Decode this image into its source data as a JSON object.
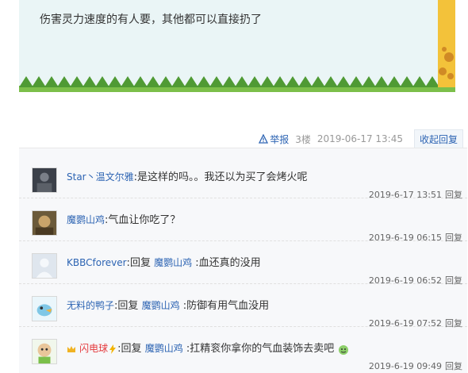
{
  "post": {
    "text": "伤害灵力速度的有人要，其他都可以直接扔了"
  },
  "meta": {
    "report": "举报",
    "floor": "3楼",
    "date": "2019-06-17 13:45",
    "collapse": "收起回复"
  },
  "comments": [
    {
      "user": "Star丶温文尔雅",
      "sep": ":",
      "text": "是这样的吗。。我还以为买了会烤火呢",
      "time": "2019-6-17 13:51",
      "reply": "回复"
    },
    {
      "user": "魔鹦山鸡",
      "sep": ":",
      "text": "气血让你吃了？",
      "time": "2019-6-19 06:15",
      "reply": "回复"
    },
    {
      "user": "KBBCforever",
      "sep": ":",
      "reply_word": "回复",
      "target": "魔鹦山鸡",
      "text": ":血还真的没用",
      "time": "2019-6-19 06:52",
      "reply": "回复"
    },
    {
      "user": "无料的鸭子",
      "sep": ":",
      "reply_word": "回复",
      "target": "魔鹦山鸡",
      "text": ":防御有用气血没用",
      "time": "2019-6-19 07:52",
      "reply": "回复"
    },
    {
      "user": "闪电球",
      "sep": ":",
      "reply_word": "回复",
      "target": "魔鹦山鸡",
      "text": ":扛精衮你拿你的气血装饰去卖吧",
      "time": "2019-6-19 09:49",
      "reply": "回复"
    }
  ],
  "colors": {
    "link": "#2d64b3",
    "card_bg": "#eaf5f6",
    "grass": "#5a9b3c",
    "panel_bg": "#f7f8fa"
  }
}
